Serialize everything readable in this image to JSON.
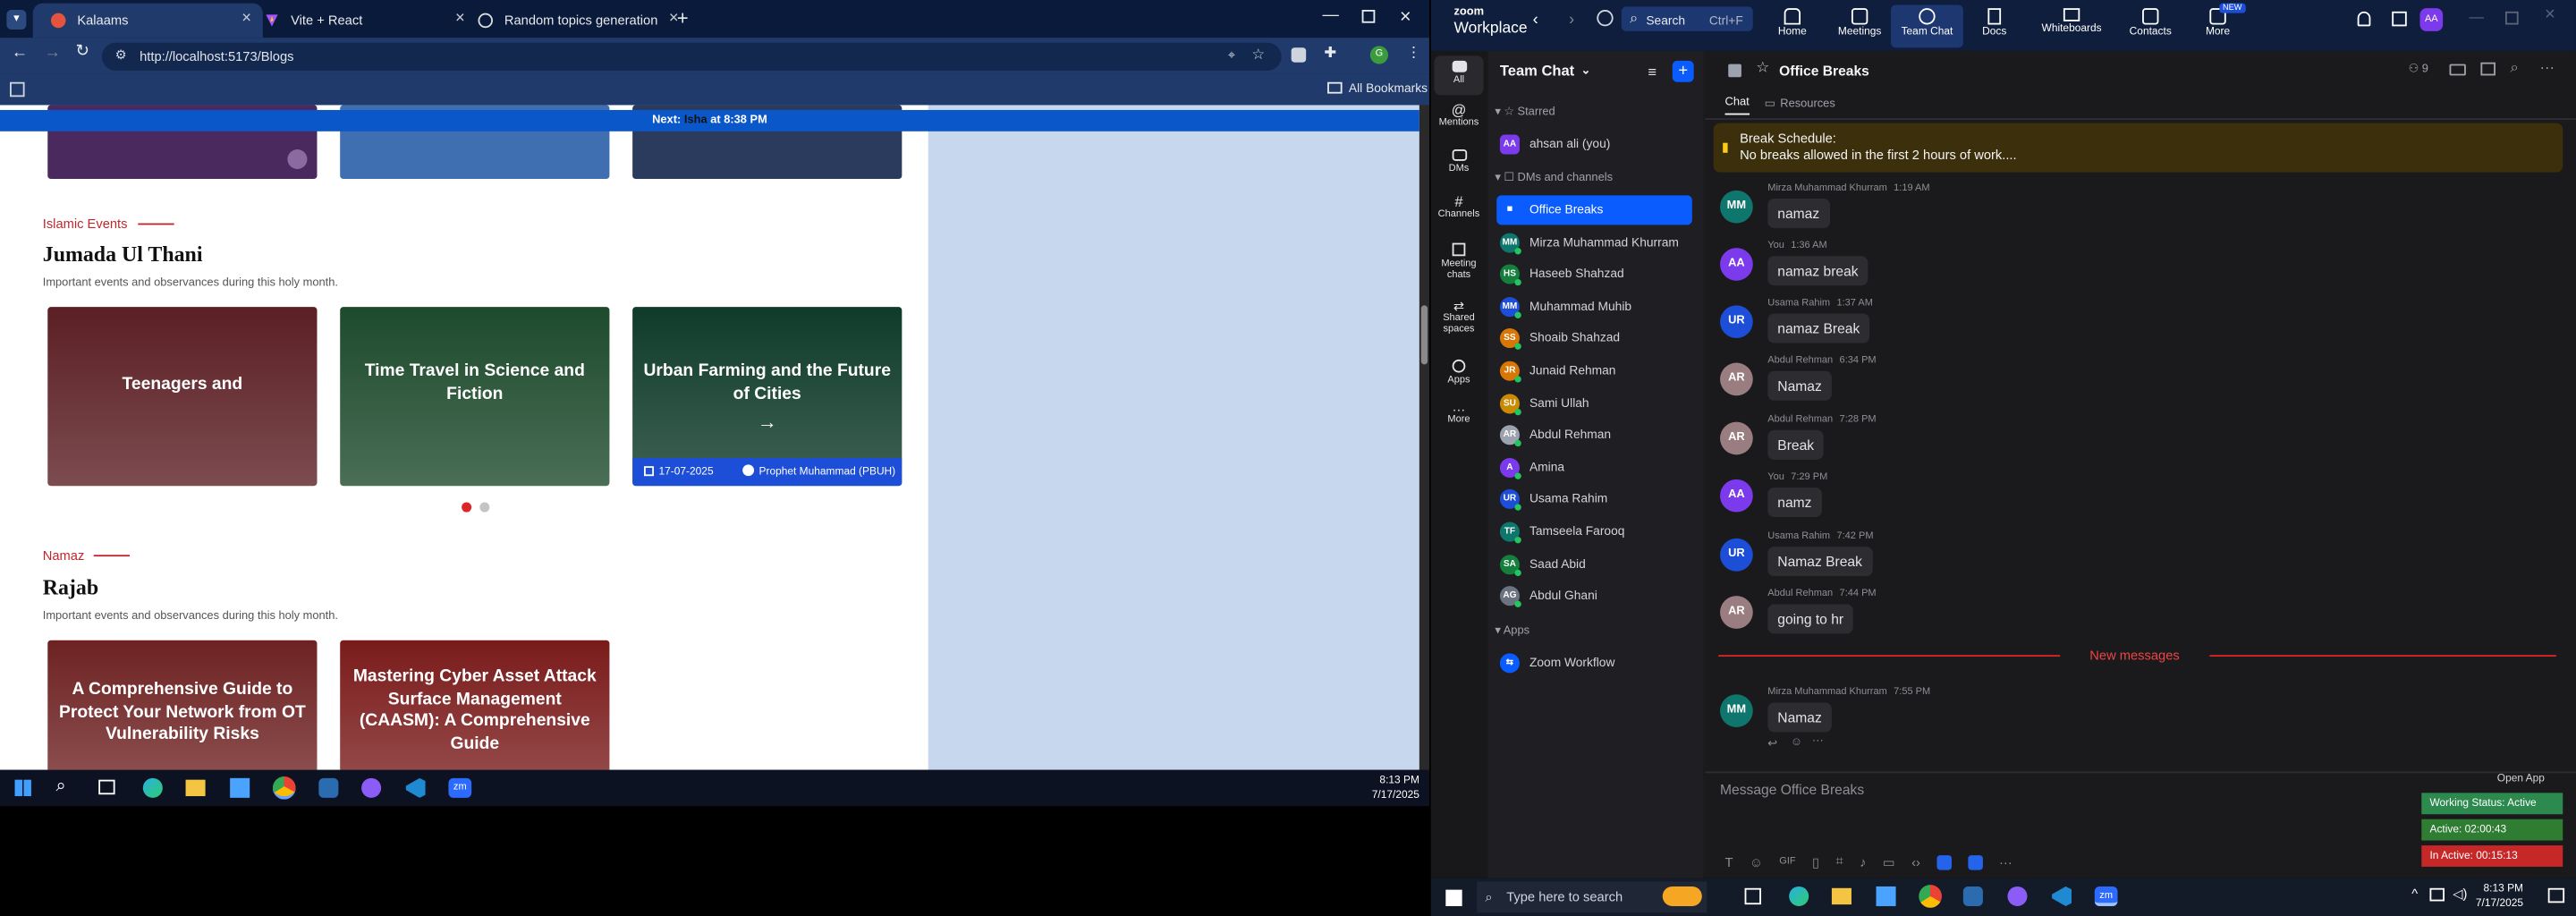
{
  "browser": {
    "tabs": [
      {
        "label": "Kalaams",
        "active": true
      },
      {
        "label": "Vite + React",
        "active": false
      },
      {
        "label": "Random topics generation",
        "active": false
      }
    ],
    "url": "http://localhost:5173/Blogs",
    "all_bookmarks": "All Bookmarks",
    "banner_prefix": "Next:",
    "banner_highlight": "Isha",
    "banner_suffix": "at 8:38 PM",
    "sections": [
      {
        "tag": "Islamic Events",
        "title": "Jumada Ul Thani",
        "subtitle": "Important events and observances during this holy month.",
        "cards": [
          {
            "title": "Teenagers and",
            "color": "#5b1f24"
          },
          {
            "title": "Time Travel in Science and Fiction",
            "color": "#1d4a2c"
          },
          {
            "title": "Urban Farming and the Future of Cities",
            "color": "#0f3b2a",
            "date": "17-07-2025",
            "category": "Prophet Muhammad (PBUH)"
          }
        ]
      },
      {
        "tag": "Namaz",
        "title": "Rajab",
        "subtitle": "Important events and observances during this holy month.",
        "cards": [
          {
            "title": "A Comprehensive Guide to Protect Your Network from OT Vulnerability Risks",
            "color": "#6e2222"
          },
          {
            "title": "Mastering Cyber Asset Attack Surface Management (CAASM): A Comprehensive Guide",
            "color": "#7a1b1b"
          }
        ]
      }
    ],
    "clock": {
      "time": "8:13 PM",
      "date": "7/17/2025"
    }
  },
  "zoom": {
    "brand_top": "zoom",
    "brand_bottom": "Workplace",
    "search_label": "Search",
    "search_shortcut": "Ctrl+F",
    "nav": [
      {
        "label": "Home",
        "icon": "home-icon"
      },
      {
        "label": "Meetings",
        "icon": "meetings-icon"
      },
      {
        "label": "Team Chat",
        "icon": "team-chat-icon",
        "active": true
      },
      {
        "label": "Docs",
        "icon": "docs-icon"
      },
      {
        "label": "Whiteboards",
        "icon": "whiteboards-icon"
      },
      {
        "label": "Contacts",
        "icon": "contacts-icon"
      },
      {
        "label": "More",
        "icon": "more-icon",
        "badge": "NEW"
      }
    ],
    "user_avatar": "AA",
    "rail": [
      {
        "label": "All",
        "active": true
      },
      {
        "label": "Mentions"
      },
      {
        "label": "DMs"
      },
      {
        "label": "Channels"
      },
      {
        "label": "Meeting chats"
      },
      {
        "label": "Shared spaces"
      },
      {
        "label": "Apps"
      },
      {
        "label": "More"
      }
    ],
    "list_title": "Team Chat",
    "starred_label": "Starred",
    "starred": [
      {
        "name": "ahsan ali (you)",
        "initials": "AA",
        "color": "#7c3aed"
      }
    ],
    "dms_label": "DMs and channels",
    "channels": [
      {
        "name": "Office Breaks",
        "active": true
      },
      {
        "name": "Mirza Muhammad Khurram",
        "initials": "MM",
        "color": "#0f766e"
      },
      {
        "name": "Haseeb Shahzad",
        "initials": "HS",
        "color": "#15803d"
      },
      {
        "name": "Muhammad Muhib",
        "initials": "MM",
        "color": "#1d4ed8"
      },
      {
        "name": "Shoaib Shahzad",
        "initials": "SS",
        "color": "#d97706"
      },
      {
        "name": "Junaid Rehman",
        "initials": "JR",
        "color": "#d97706"
      },
      {
        "name": "Sami Ullah",
        "initials": "SU",
        "color": "#ca8a04"
      },
      {
        "name": "Abdul Rehman",
        "initials": "AR",
        "color": "#9ca3af"
      },
      {
        "name": "Amina",
        "initials": "A",
        "color": "#7c3aed"
      },
      {
        "name": "Usama Rahim",
        "initials": "UR",
        "color": "#1d4ed8"
      },
      {
        "name": "Tamseela Farooq",
        "initials": "TF",
        "color": "#0f766e"
      },
      {
        "name": "Saad Abid",
        "initials": "SA",
        "color": "#15803d"
      },
      {
        "name": "Abdul Ghani",
        "initials": "AG",
        "color": "#6b7280"
      }
    ],
    "apps_label": "Apps",
    "apps": [
      {
        "name": "Zoom Workflow"
      }
    ],
    "chat_title": "Office Breaks",
    "member_count": "9",
    "chat_tabs": [
      "Chat",
      "Resources"
    ],
    "pinned_title": "Break Schedule:",
    "pinned_text": "No breaks allowed in the first 2 hours of work....",
    "messages": [
      {
        "author": "Mirza Muhammad Khurram",
        "time": "1:19 AM",
        "text": "namaz",
        "initials": "MM",
        "color": "#0f766e"
      },
      {
        "author": "You",
        "time": "1:36 AM",
        "text": "namaz break",
        "initials": "AA",
        "color": "#7c3aed"
      },
      {
        "author": "Usama Rahim",
        "time": "1:37 AM",
        "text": "namaz Break",
        "initials": "UR",
        "color": "#1d4ed8"
      },
      {
        "author": "Abdul Rehman",
        "time": "6:34 PM",
        "text": "Namaz",
        "initials": "AR",
        "color": "#9a7d80"
      },
      {
        "author": "Abdul Rehman",
        "time": "7:28 PM",
        "text": "Break",
        "initials": "AR",
        "color": "#9a7d80"
      },
      {
        "author": "You",
        "time": "7:29 PM",
        "text": "namz",
        "initials": "AA",
        "color": "#7c3aed"
      },
      {
        "author": "Usama Rahim",
        "time": "7:42 PM",
        "text": "Namaz Break",
        "initials": "UR",
        "color": "#1d4ed8"
      },
      {
        "author": "Abdul Rehman",
        "time": "7:44 PM",
        "text": "going to hr",
        "initials": "AR",
        "color": "#9a7d80"
      },
      {
        "author": "Mirza Muhammad Khurram",
        "time": "7:55 PM",
        "text": "Namaz",
        "initials": "MM",
        "color": "#0f766e"
      }
    ],
    "new_messages_label": "New messages",
    "composer_placeholder": "Message Office Breaks",
    "open_app": "Open App",
    "status": [
      {
        "label": "Working Status: Active",
        "color": "#2d8a4e"
      },
      {
        "label": "Active: 02:00:43",
        "color": "#2e7d32"
      },
      {
        "label": "In Active: 00:15:13",
        "color": "#c62828"
      }
    ],
    "taskbar_search": "Type here to search",
    "clock": {
      "time": "8:13 PM",
      "date": "7/17/2025"
    }
  }
}
